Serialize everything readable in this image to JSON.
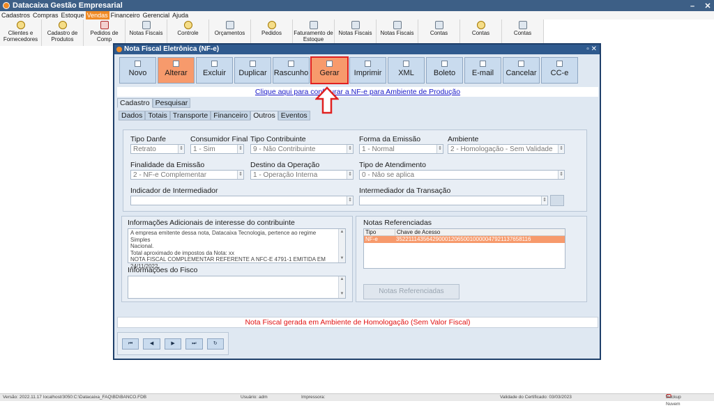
{
  "window": {
    "title": "Datacaixa Gestão Empresarial"
  },
  "menu": [
    "Cadastros",
    "Compras",
    "Estoque",
    "Vendas",
    "Financeiro",
    "Gerencial",
    "Ajuda"
  ],
  "menu_active": "Vendas",
  "toolbar": {
    "items": [
      "Clientes e Fornecedores",
      "Cadastro de Produtos",
      "Pedidos de Comp",
      "Notas Fiscais",
      "Controle",
      "Orçamentos",
      "Pedidos",
      "Faturamento de Estoque",
      "Notas Fiscais",
      "Notas Fiscais",
      "Contas",
      "Contas",
      "Contas"
    ]
  },
  "dialog": {
    "title": "Nota Fiscal Eletrônica (NF-e)",
    "actions": [
      "Novo",
      "Alterar",
      "Excluir",
      "Duplicar",
      "Rascunho",
      "Gerar",
      "Imprimir",
      "XML",
      "Boleto",
      "E-mail",
      "Cancelar",
      "CC-e"
    ],
    "production_link": "Clique aqui para configurar a NF-e para Ambiente de Produção",
    "main_tabs": [
      "Cadastro",
      "Pesquisar"
    ],
    "sub_tabs": [
      "Dados",
      "Totais",
      "Transporte",
      "Financeiro",
      "Outros",
      "Eventos"
    ],
    "selected_sub_tab": "Outros",
    "fields": {
      "tipo_danfe": {
        "label": "Tipo Danfe",
        "value": "Retrato"
      },
      "consumidor_final": {
        "label": "Consumidor Final",
        "value": "1 - Sim"
      },
      "tipo_contribuinte": {
        "label": "Tipo Contribuinte",
        "value": "9 - Não Contribuinte"
      },
      "forma_emissao": {
        "label": "Forma da Emissão",
        "value": "1 - Normal"
      },
      "ambiente": {
        "label": "Ambiente",
        "value": "2 - Homologação - Sem Validade"
      },
      "finalidade": {
        "label": "Finalidade da Emissão",
        "value": "2 - NF-e Complementar"
      },
      "destino": {
        "label": "Destino da Operação",
        "value": "1 - Operação Interna"
      },
      "tipo_atendimento": {
        "label": "Tipo de Atendimento",
        "value": "0 - Não se aplica"
      },
      "indicador_intermediador": {
        "label": "Indicador de Intermediador",
        "value": ""
      },
      "intermediador_transacao": {
        "label": "Intermediador da Transação",
        "value": ""
      }
    },
    "info_adicionais": {
      "label": "Informações Adicionais de interesse do contribuinte",
      "lines": [
        "A empresa emitente dessa nota, Datacaixa Tecnologia, pertence ao regime Simples",
        "Nacional.",
        "Total aproximado de impostos da Nota:  xx",
        "NOTA FISCAL COMPLEMENTAR REFERENTE A NFC-E 4791-1 EMITIDA EM",
        "24/11/2022."
      ]
    },
    "info_fisco": {
      "label": "Informações do Fisco",
      "value": ""
    },
    "notas_referenciadas": {
      "label": "Notas Referenciadas",
      "columns": [
        "Tipo",
        "Chave de Acesso"
      ],
      "rows": [
        {
          "tipo": "NF-e",
          "chave": "35221114356429000120650010000047921137658116"
        }
      ],
      "button": "Notas Referenciadas"
    },
    "status_message": "Nota Fiscal gerada em Ambiente de Homologação (Sem Valor Fiscal)"
  },
  "statusbar": {
    "versao": "Versão: 2022.11.17",
    "db": "localhost/3050:C:\\Datacaixa_FAQ\\BD\\BANCO.FDB",
    "usuario": "Usuário: adm",
    "impressora": "Impressora:",
    "certificado": "Validade do Certificado: 03/03/2023",
    "backup": "Backup Nuvem"
  },
  "colors": {
    "accent": "#f79a6c",
    "titlebar": "#2f5a8e",
    "highlight": "#e02020"
  }
}
